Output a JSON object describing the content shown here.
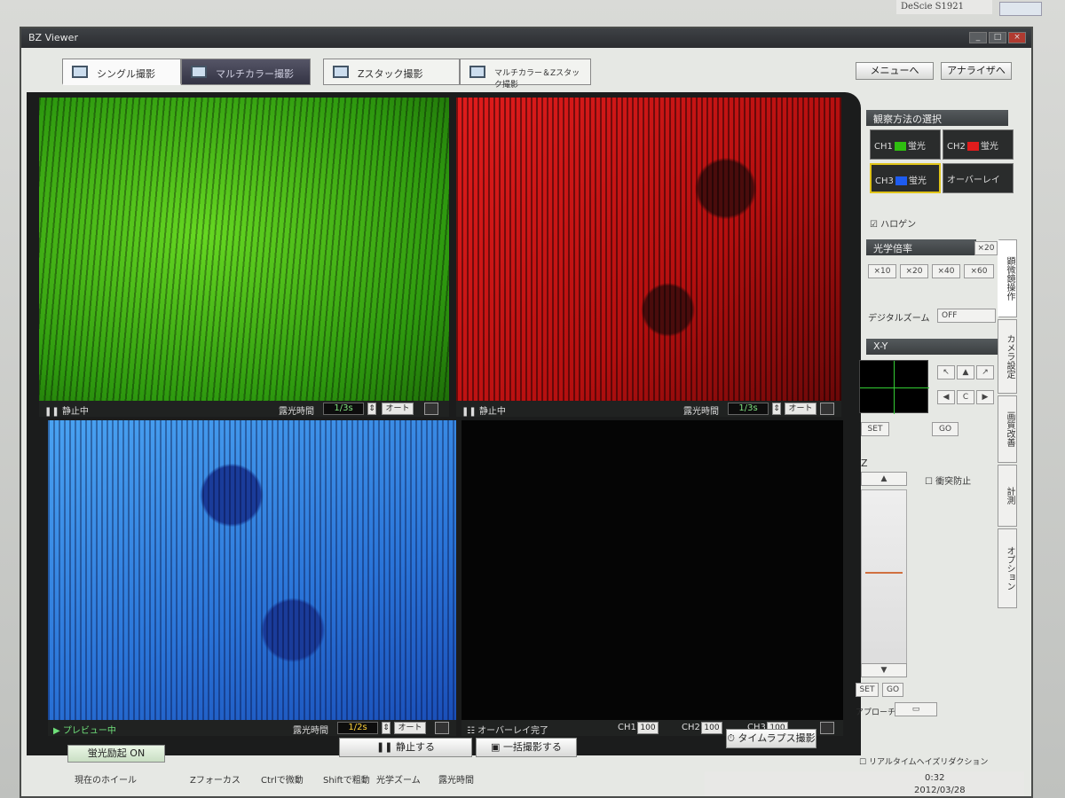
{
  "monitor": {
    "brand": "DeScie S1921",
    "logo_label": "Logo"
  },
  "window": {
    "title": "BZ Viewer",
    "min": "_",
    "max": "□",
    "close": "×"
  },
  "tabs": [
    {
      "label": "シングル撮影"
    },
    {
      "label": "マルチカラー撮影"
    },
    {
      "label": "Zスタック撮影"
    },
    {
      "label": "マルチカラー＆Zスタック撮影"
    }
  ],
  "top_buttons": {
    "menu": "メニューへ",
    "analyzer": "アナライザへ"
  },
  "panes": {
    "ch1": {
      "status": "静止中",
      "exposure_label": "露光時間",
      "exposure_value": "1/3s",
      "auto": "オート"
    },
    "ch2": {
      "status": "静止中",
      "exposure_label": "露光時間",
      "exposure_value": "1/3s",
      "auto": "オート"
    },
    "ch3": {
      "status": "プレビュー中",
      "exposure_label": "露光時間",
      "exposure_value": "1/2s",
      "auto": "オート"
    },
    "overlay": {
      "status": "オーバーレイ完了",
      "ch1_label": "CH1",
      "ch1_value": "100",
      "ch2_label": "CH2",
      "ch2_value": "100",
      "ch3_label": "CH3",
      "ch3_value": "100"
    }
  },
  "right_panel": {
    "method_title": "観察方法の選択",
    "ch1": {
      "prefix": "CH1",
      "label": "蛍光"
    },
    "ch2": {
      "prefix": "CH2",
      "label": "蛍光"
    },
    "ch3": {
      "prefix": "CH3",
      "label": "蛍光"
    },
    "overlay": "オーバーレイ",
    "halogen": "ハロゲン",
    "magnification_title": "光学倍率",
    "mag_current": "×20",
    "mags": [
      "×10",
      "×20",
      "×40",
      "×60"
    ],
    "digital_zoom_label": "デジタルズーム",
    "digital_zoom_value": "OFF",
    "xy_title": "X-Y",
    "set": "SET",
    "go": "GO",
    "z_title": "Z",
    "collision": "衝突防止",
    "z_set": "SET",
    "z_go": "GO",
    "approach": "アプローチ",
    "realtime": "リアルタイムヘイズリダクション"
  },
  "vertical_tabs": [
    "顕微鏡操作",
    "カメラ設定",
    "画質改善",
    "計測",
    "オプション"
  ],
  "bottom_buttons": {
    "fluor": "蛍光励起 ON",
    "stop": "静止する",
    "batch": "一括撮影する",
    "timelapse": "タイムラプス撮影"
  },
  "status_bar": [
    "現在のホイール",
    "Zフォーカス",
    "Ctrlで微動",
    "Shiftで粗動",
    "光学ズーム",
    "露光時間"
  ],
  "tray": {
    "time": "0:32",
    "date": "2012/03/28"
  },
  "colors": {
    "ch1": "#2fbf10",
    "ch2": "#e01c1c",
    "ch3": "#1e5cf0",
    "selection": "#e0c419"
  }
}
